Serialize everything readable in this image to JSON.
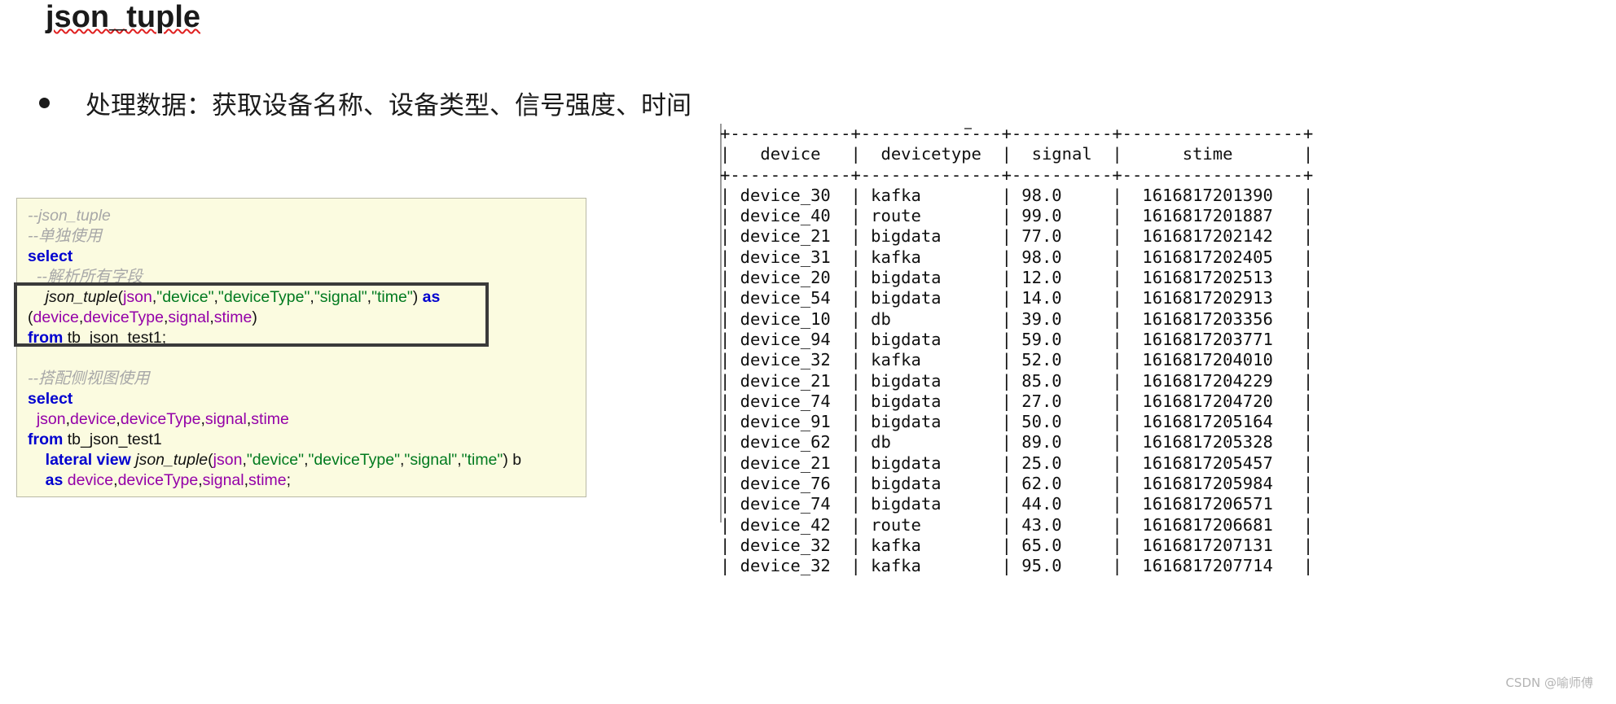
{
  "title": {
    "text": "json_tuple"
  },
  "bullet": {
    "marker": "bullet-dot",
    "text": "处理数据：获取设备名称、设备类型、信号强度、时间"
  },
  "code_panel": {
    "background_color": "#fbfbe0",
    "border_color": "#b9b9a6",
    "highlight_border_color": "#3a3a3a",
    "colors": {
      "comment": "#a8a8a8",
      "keyword": "#0000cf",
      "function": "#111111",
      "identifier": "#9400a8",
      "string": "#007a1f",
      "plain": "#111111"
    },
    "lines": [
      {
        "id": "l1",
        "indent": 0,
        "tokens": [
          {
            "t": "cmt",
            "v": "--json_tuple"
          }
        ]
      },
      {
        "id": "l2",
        "indent": 0,
        "tokens": [
          {
            "t": "cmt",
            "v": "--单独使用"
          }
        ]
      },
      {
        "id": "l3",
        "indent": 0,
        "tokens": [
          {
            "t": "kw",
            "v": "select"
          }
        ]
      },
      {
        "id": "l4",
        "indent": 1,
        "tokens": [
          {
            "t": "cmt",
            "v": "--解析所有字段"
          }
        ]
      },
      {
        "id": "l5",
        "indent": 2,
        "tokens": [
          {
            "t": "fn",
            "v": "json_tuple"
          },
          {
            "t": "pln",
            "v": "("
          },
          {
            "t": "var",
            "v": "json"
          },
          {
            "t": "pln",
            "v": ","
          },
          {
            "t": "str",
            "v": "\"device\""
          },
          {
            "t": "pln",
            "v": ","
          },
          {
            "t": "str",
            "v": "\"deviceType\""
          },
          {
            "t": "pln",
            "v": ","
          },
          {
            "t": "str",
            "v": "\"signal\""
          },
          {
            "t": "pln",
            "v": ","
          },
          {
            "t": "str",
            "v": "\"time\""
          },
          {
            "t": "pln",
            "v": ") "
          },
          {
            "t": "kw",
            "v": "as"
          }
        ]
      },
      {
        "id": "l6",
        "indent": 0,
        "tokens": [
          {
            "t": "pln",
            "v": "("
          },
          {
            "t": "var",
            "v": "device"
          },
          {
            "t": "pln",
            "v": ","
          },
          {
            "t": "var",
            "v": "deviceType"
          },
          {
            "t": "pln",
            "v": ","
          },
          {
            "t": "var",
            "v": "signal"
          },
          {
            "t": "pln",
            "v": ","
          },
          {
            "t": "var",
            "v": "stime"
          },
          {
            "t": "pln",
            "v": ")"
          }
        ]
      },
      {
        "id": "l7",
        "indent": 0,
        "tokens": [
          {
            "t": "kw",
            "v": "from"
          },
          {
            "t": "pln",
            "v": " tb_json_test1;"
          }
        ]
      },
      {
        "id": "l8",
        "indent": 0,
        "tokens": [
          {
            "t": "pln",
            "v": ""
          }
        ]
      },
      {
        "id": "l9",
        "indent": 0,
        "tokens": [
          {
            "t": "cmt",
            "v": "--搭配侧视图使用"
          }
        ]
      },
      {
        "id": "l10",
        "indent": 0,
        "tokens": [
          {
            "t": "kw",
            "v": "select"
          }
        ]
      },
      {
        "id": "l11",
        "indent": 1,
        "tokens": [
          {
            "t": "var",
            "v": "json"
          },
          {
            "t": "pln",
            "v": ","
          },
          {
            "t": "var",
            "v": "device"
          },
          {
            "t": "pln",
            "v": ","
          },
          {
            "t": "var",
            "v": "deviceType"
          },
          {
            "t": "pln",
            "v": ","
          },
          {
            "t": "var",
            "v": "signal"
          },
          {
            "t": "pln",
            "v": ","
          },
          {
            "t": "var",
            "v": "stime"
          }
        ]
      },
      {
        "id": "l12",
        "indent": 0,
        "tokens": [
          {
            "t": "kw",
            "v": "from"
          },
          {
            "t": "pln",
            "v": " tb_json_test1"
          }
        ]
      },
      {
        "id": "l13",
        "indent": 2,
        "tokens": [
          {
            "t": "kw",
            "v": "lateral view "
          },
          {
            "t": "fn",
            "v": "json_tuple"
          },
          {
            "t": "pln",
            "v": "("
          },
          {
            "t": "var",
            "v": "json"
          },
          {
            "t": "pln",
            "v": ","
          },
          {
            "t": "str",
            "v": "\"device\""
          },
          {
            "t": "pln",
            "v": ","
          },
          {
            "t": "str",
            "v": "\"deviceType\""
          },
          {
            "t": "pln",
            "v": ","
          },
          {
            "t": "str",
            "v": "\"signal\""
          },
          {
            "t": "pln",
            "v": ","
          },
          {
            "t": "str",
            "v": "\"time\""
          },
          {
            "t": "pln",
            "v": ") b"
          }
        ]
      },
      {
        "id": "l14",
        "indent": 2,
        "tokens": [
          {
            "t": "kw",
            "v": "as "
          },
          {
            "t": "var",
            "v": "device"
          },
          {
            "t": "pln",
            "v": ","
          },
          {
            "t": "var",
            "v": "deviceType"
          },
          {
            "t": "pln",
            "v": ","
          },
          {
            "t": "var",
            "v": "signal"
          },
          {
            "t": "pln",
            "v": ","
          },
          {
            "t": "var",
            "v": "stime"
          },
          {
            "t": "pln",
            "v": ";"
          }
        ]
      }
    ]
  },
  "result_table": {
    "columns": [
      {
        "name": "device",
        "width": 12
      },
      {
        "name": "devicetype",
        "width": 14
      },
      {
        "name": "signal",
        "width": 10
      },
      {
        "name": "stime",
        "width": 18
      }
    ],
    "rows": [
      {
        "device": "device_30",
        "devicetype": "kafka",
        "signal": "98.0",
        "stime": "1616817201390"
      },
      {
        "device": "device_40",
        "devicetype": "route",
        "signal": "99.0",
        "stime": "1616817201887"
      },
      {
        "device": "device_21",
        "devicetype": "bigdata",
        "signal": "77.0",
        "stime": "1616817202142"
      },
      {
        "device": "device_31",
        "devicetype": "kafka",
        "signal": "98.0",
        "stime": "1616817202405"
      },
      {
        "device": "device_20",
        "devicetype": "bigdata",
        "signal": "12.0",
        "stime": "1616817202513"
      },
      {
        "device": "device_54",
        "devicetype": "bigdata",
        "signal": "14.0",
        "stime": "1616817202913"
      },
      {
        "device": "device_10",
        "devicetype": "db",
        "signal": "39.0",
        "stime": "1616817203356"
      },
      {
        "device": "device_94",
        "devicetype": "bigdata",
        "signal": "59.0",
        "stime": "1616817203771"
      },
      {
        "device": "device_32",
        "devicetype": "kafka",
        "signal": "52.0",
        "stime": "1616817204010"
      },
      {
        "device": "device_21",
        "devicetype": "bigdata",
        "signal": "85.0",
        "stime": "1616817204229"
      },
      {
        "device": "device_74",
        "devicetype": "bigdata",
        "signal": "27.0",
        "stime": "1616817204720"
      },
      {
        "device": "device_91",
        "devicetype": "bigdata",
        "signal": "50.0",
        "stime": "1616817205164"
      },
      {
        "device": "device_62",
        "devicetype": "db",
        "signal": "89.0",
        "stime": "1616817205328"
      },
      {
        "device": "device_21",
        "devicetype": "bigdata",
        "signal": "25.0",
        "stime": "1616817205457"
      },
      {
        "device": "device_76",
        "devicetype": "bigdata",
        "signal": "62.0",
        "stime": "1616817205984"
      },
      {
        "device": "device_74",
        "devicetype": "bigdata",
        "signal": "44.0",
        "stime": "1616817206571"
      },
      {
        "device": "device_42",
        "devicetype": "route",
        "signal": "43.0",
        "stime": "1616817206681"
      },
      {
        "device": "device_32",
        "devicetype": "kafka",
        "signal": "65.0",
        "stime": "1616817207131"
      },
      {
        "device": "device_32",
        "devicetype": "kafka",
        "signal": "95.0",
        "stime": "1616817207714"
      }
    ]
  },
  "watermark": {
    "text": "CSDN @喻师傅"
  }
}
